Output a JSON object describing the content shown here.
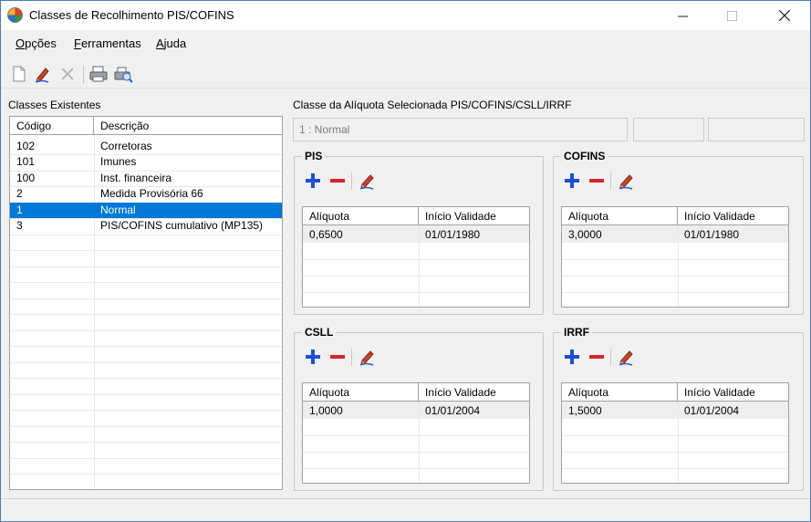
{
  "window": {
    "title": "Classes de Recolhimento PIS/COFINS",
    "controls": {
      "minimize": "—",
      "maximize": "☐",
      "close": "✕"
    }
  },
  "menu": {
    "items": [
      {
        "label": "Opções",
        "mnemonic": "O"
      },
      {
        "label": "Ferramentas",
        "mnemonic": "F"
      },
      {
        "label": "Ajuda",
        "mnemonic": "A"
      }
    ]
  },
  "toolbar": {
    "buttons": [
      {
        "icon": "new-document-icon"
      },
      {
        "icon": "edit-pencil-icon"
      },
      {
        "icon": "delete-x-icon"
      },
      {
        "icon": "print-icon"
      },
      {
        "icon": "print-preview-icon"
      }
    ]
  },
  "left": {
    "label": "Classes Existentes",
    "columns": [
      "Código",
      "Descrição"
    ],
    "rows": [
      {
        "code": "102",
        "desc": "Corretoras"
      },
      {
        "code": "101",
        "desc": "Imunes"
      },
      {
        "code": "100",
        "desc": "Inst. financeira"
      },
      {
        "code": "2",
        "desc": "Medida Provisória 66"
      },
      {
        "code": "1",
        "desc": "Normal"
      },
      {
        "code": "3",
        "desc": "PIS/COFINS cumulativo (MP135)"
      }
    ],
    "selected_index": 4
  },
  "right": {
    "label": "Classe da Alíquota Selecionada PIS/COFINS/CSLL/IRRF",
    "selected_value": "1 : Normal",
    "extra_field_1": "",
    "extra_field_2": ""
  },
  "groups": {
    "pis": {
      "title": "PIS",
      "columns": [
        "Alíquota",
        "Início Validade"
      ],
      "rate": "0,6500",
      "start": "01/01/1980"
    },
    "cofins": {
      "title": "COFINS",
      "columns": [
        "Alíquota",
        "Início Validade"
      ],
      "rate": "3,0000",
      "start": "01/01/1980"
    },
    "csll": {
      "title": "CSLL",
      "columns": [
        "Alíquota",
        "Início Validade"
      ],
      "rate": "1,0000",
      "start": "01/01/2004"
    },
    "irrf": {
      "title": "IRRF",
      "columns": [
        "Alíquota",
        "Início Validade"
      ],
      "rate": "1,5000",
      "start": "01/01/2004"
    }
  },
  "colors": {
    "selection": "#0078d7",
    "plus": "#1f4fd1",
    "minus": "#d7262b"
  }
}
